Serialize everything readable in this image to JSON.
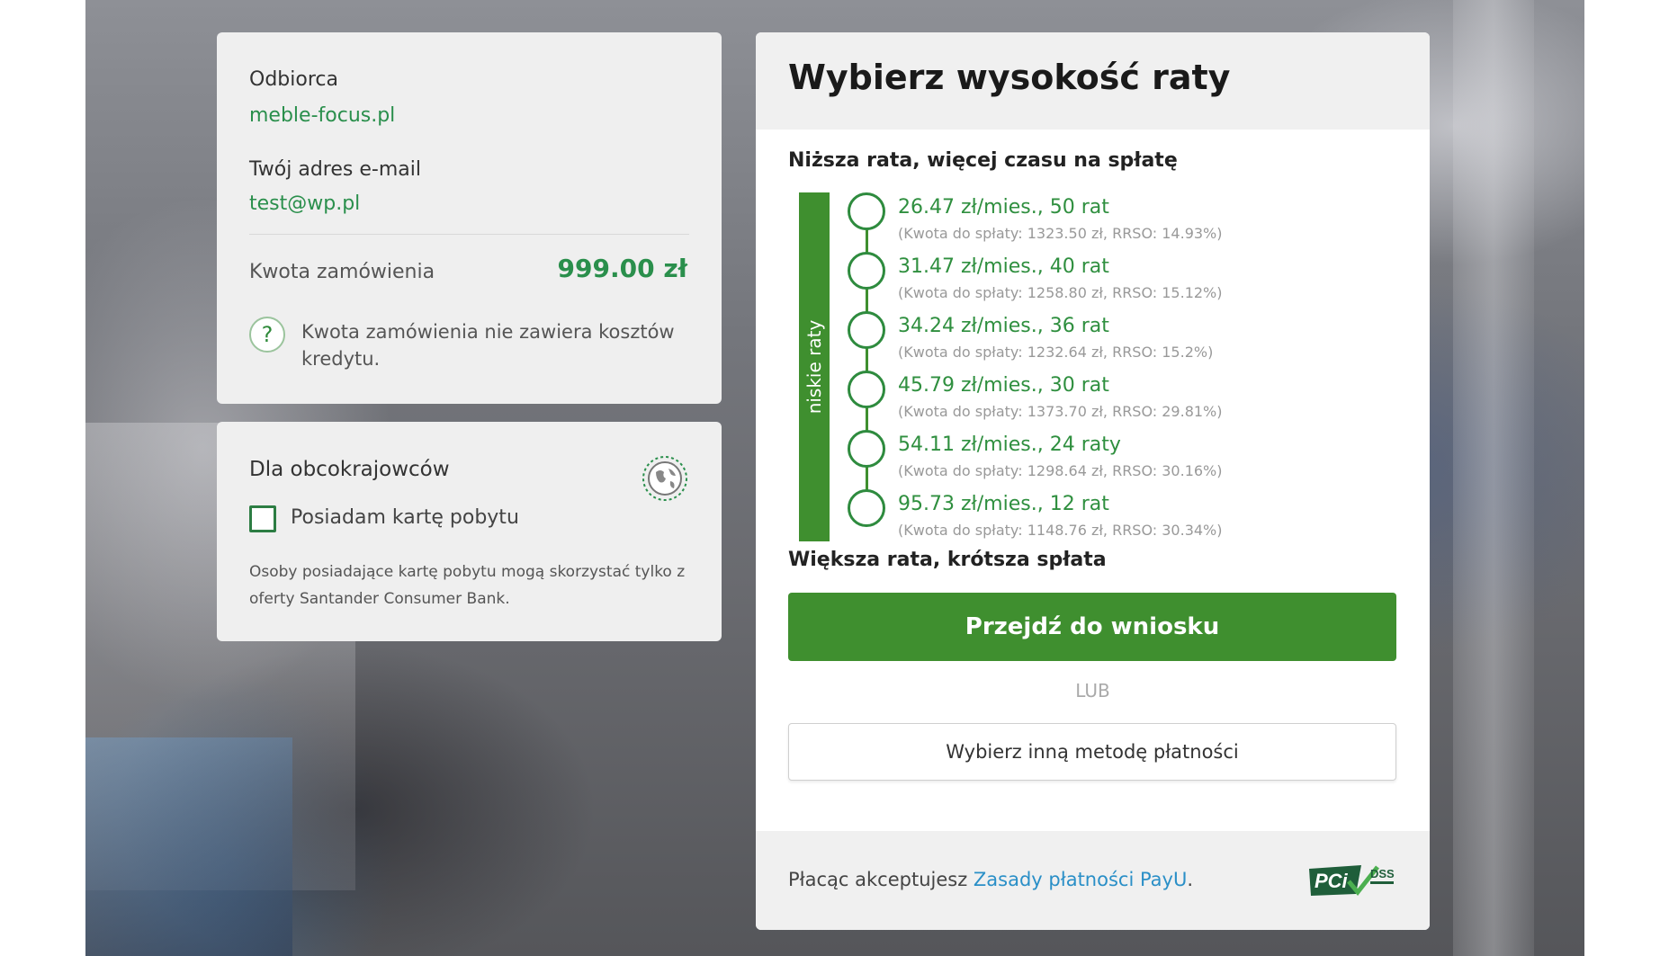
{
  "recipient": {
    "label": "Odbiorca",
    "value": "meble-focus.pl",
    "email_label": "Twój adres e-mail",
    "email_value": "test@wp.pl",
    "amount_label": "Kwota zamówienia",
    "amount_value": "999.00 zł",
    "note": "Kwota zamówienia nie zawiera kosztów kredytu.",
    "help_icon": "question-mark-icon"
  },
  "foreigners": {
    "title": "Dla obcokrajowców",
    "icon": "globe-icon",
    "checkbox_label": "Posiadam kartę pobytu",
    "checkbox_checked": false,
    "note": "Osoby posiadające kartę pobytu mogą skorzystać tylko z oferty Santander Consumer Bank."
  },
  "installments": {
    "title": "Wybierz wysokość raty",
    "top_hint": "Niższa rata, więcej czasu na spłatę",
    "bar_label": "niskie raty",
    "bottom_hint": "Większa rata, krótsza spłata",
    "options": [
      {
        "rate": "26.47 zł/mies., 50 rat",
        "details": "(Kwota do spłaty: 1323.50 zł, RRSO: 14.93%)"
      },
      {
        "rate": "31.47 zł/mies., 40 rat",
        "details": "(Kwota do spłaty: 1258.80 zł, RRSO: 15.12%)"
      },
      {
        "rate": "34.24 zł/mies., 36 rat",
        "details": "(Kwota do spłaty: 1232.64 zł, RRSO: 15.2%)"
      },
      {
        "rate": "45.79 zł/mies., 30 rat",
        "details": "(Kwota do spłaty: 1373.70 zł, RRSO: 29.81%)"
      },
      {
        "rate": "54.11 zł/mies., 24 raty",
        "details": "(Kwota do spłaty: 1298.64 zł, RRSO: 30.16%)"
      },
      {
        "rate": "95.73 zł/mies., 12 rat",
        "details": "(Kwota do spłaty: 1148.76 zł, RRSO: 30.34%)"
      }
    ],
    "primary_button": "Przejdź do wniosku",
    "or_label": "LUB",
    "secondary_button": "Wybierz inną metodę płatności"
  },
  "footer": {
    "text": "Płacąc akceptujesz ",
    "link": "Zasady płatności PayU",
    "suffix": ".",
    "logo": "pci-dss-logo",
    "logo_text_pci": "PCi",
    "logo_text_dss": "DSS"
  },
  "colors": {
    "brand_green": "#3f8f2f",
    "link_green": "#2a8f4c",
    "link_blue": "#2a8fc7"
  }
}
